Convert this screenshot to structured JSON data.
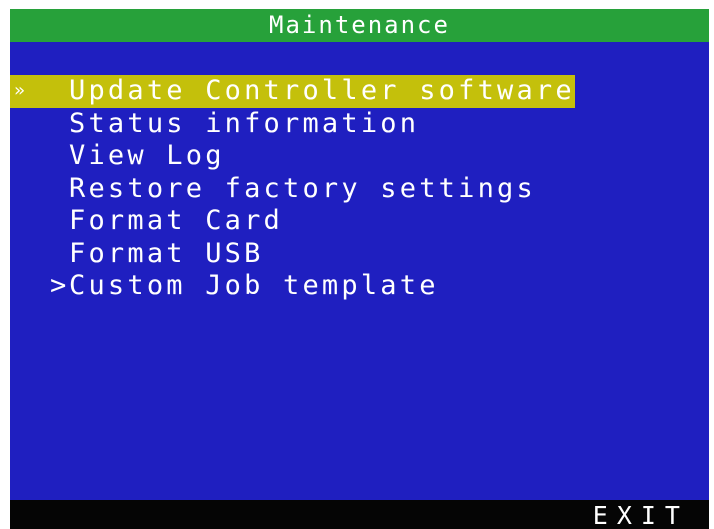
{
  "window": {
    "title": "Maintenance"
  },
  "menu": {
    "cursor_symbol": "»",
    "items": [
      {
        "label": "Update Controller software",
        "selected": true,
        "marker": ""
      },
      {
        "label": "Status information",
        "selected": false,
        "marker": ""
      },
      {
        "label": "View Log",
        "selected": false,
        "marker": ""
      },
      {
        "label": "Restore factory settings",
        "selected": false,
        "marker": ""
      },
      {
        "label": "Format Card",
        "selected": false,
        "marker": ""
      },
      {
        "label": "Format USB",
        "selected": false,
        "marker": ""
      },
      {
        "label": "Custom Job template",
        "selected": false,
        "marker": ">"
      }
    ]
  },
  "footer": {
    "exit_label": "EXIT"
  },
  "colors": {
    "background": "#1f1fc0",
    "title_bar": "#27a13a",
    "highlight": "#c4c00b",
    "footer": "#050505",
    "text": "#ffffff"
  }
}
